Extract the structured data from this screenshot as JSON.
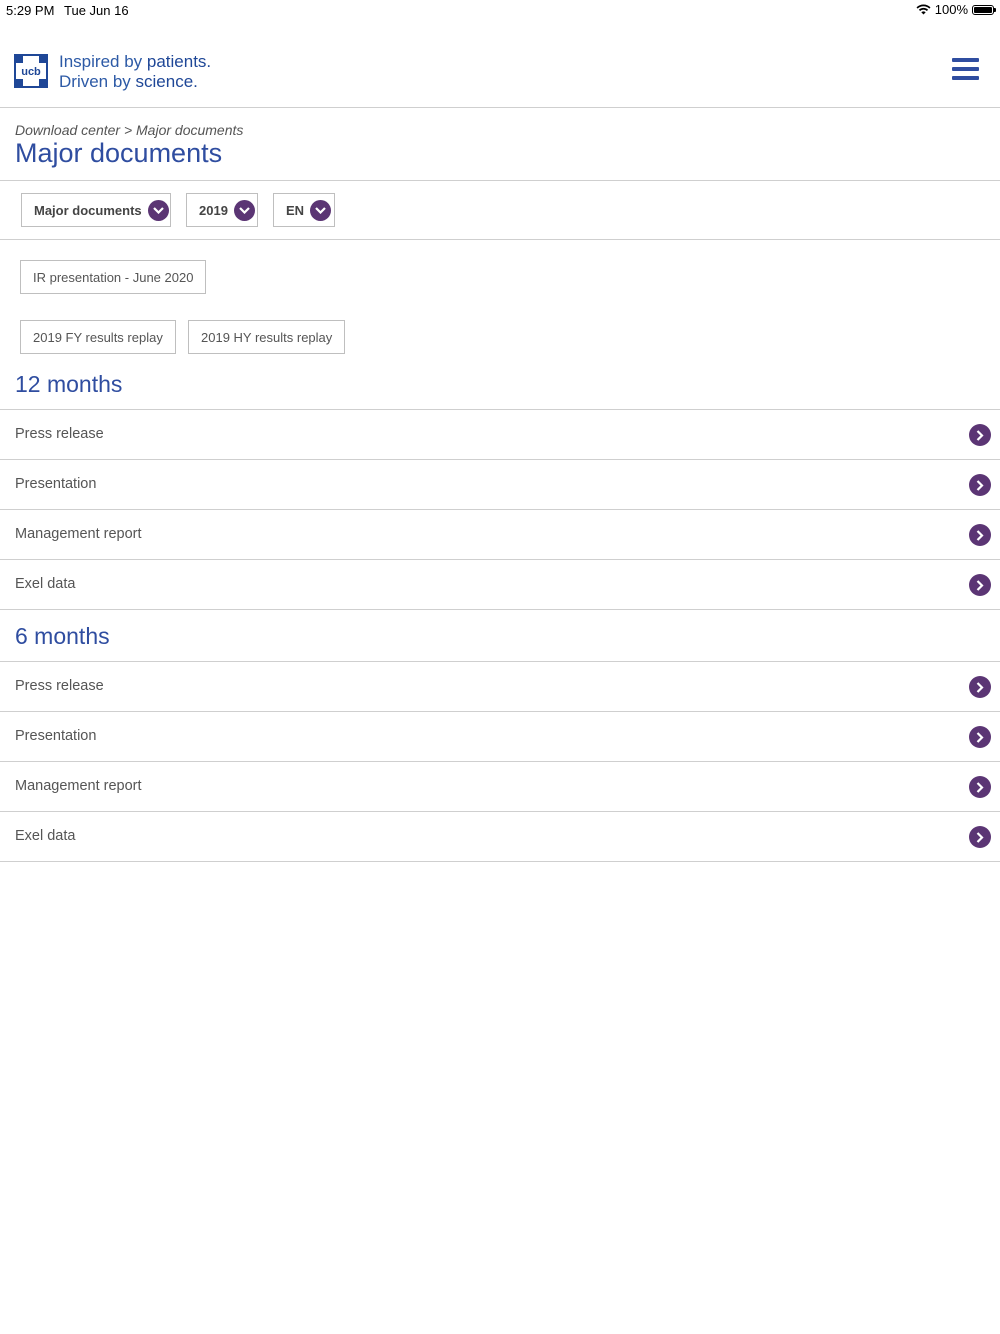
{
  "status_bar": {
    "time": "5:29 PM",
    "date": "Tue Jun 16",
    "battery": "100%"
  },
  "header": {
    "logo_text": "ucb",
    "tagline_line1_plain": "Inspired by ",
    "tagline_line1_bold": "patients.",
    "tagline_line2_plain": "Driven by ",
    "tagline_line2_bold": "science."
  },
  "breadcrumb": "Download center > Major documents",
  "page_title": "Major documents",
  "filters": {
    "category": "Major documents",
    "year": "2019",
    "language": "EN"
  },
  "chips": [
    "IR presentation - June 2020",
    "2019 FY results replay",
    "2019 HY results replay"
  ],
  "sections": [
    {
      "title": "12 months",
      "items": [
        "Press release",
        "Presentation",
        "Management report",
        "Exel data"
      ]
    },
    {
      "title": "6 months",
      "items": [
        "Press release",
        "Presentation",
        "Management report",
        "Exel data"
      ]
    }
  ],
  "colors": {
    "brand_blue": "#2f4da0",
    "accent_purple": "#5b3574",
    "divider": "#cfcfcf"
  }
}
